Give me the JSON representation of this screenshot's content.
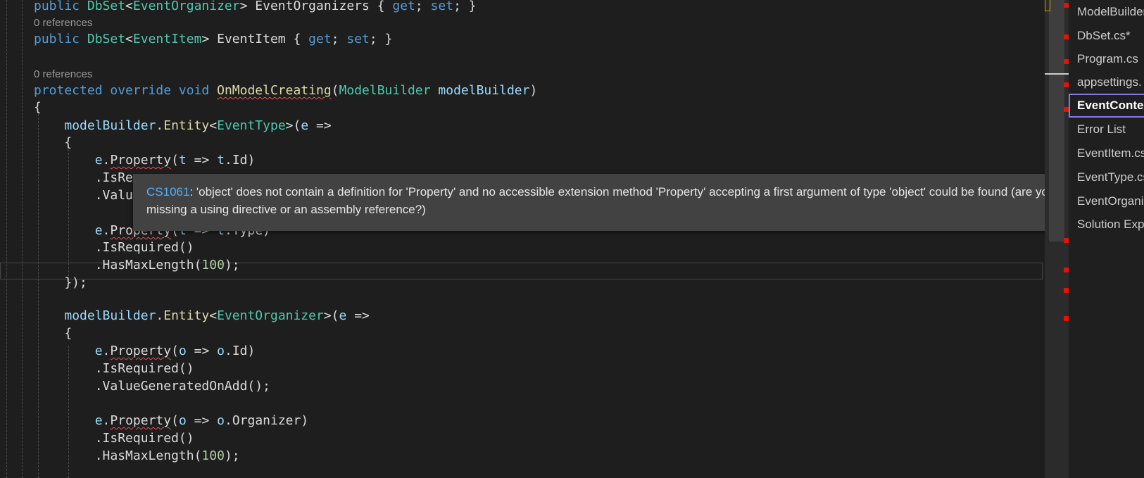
{
  "editor": {
    "code_lens": {
      "references_1": "0 references",
      "references_2": "0 references"
    },
    "lines": [
      {
        "tokens": [
          {
            "t": "public ",
            "c": "kw"
          },
          {
            "t": "DbSet",
            "c": "ty"
          },
          {
            "t": "<",
            "c": ""
          },
          {
            "t": "EventOrganizer",
            "c": "ty"
          },
          {
            "t": "> EventOrganizers { ",
            "c": ""
          },
          {
            "t": "get",
            "c": "kw"
          },
          {
            "t": "; ",
            "c": ""
          },
          {
            "t": "set",
            "c": "kw"
          },
          {
            "t": "; }",
            "c": ""
          }
        ]
      },
      {
        "tokens": [
          {
            "t": "public ",
            "c": "kw"
          },
          {
            "t": "DbSet",
            "c": "ty"
          },
          {
            "t": "<",
            "c": ""
          },
          {
            "t": "EventItem",
            "c": "ty"
          },
          {
            "t": "> EventItem { ",
            "c": ""
          },
          {
            "t": "get",
            "c": "kw"
          },
          {
            "t": "; ",
            "c": ""
          },
          {
            "t": "set",
            "c": "kw"
          },
          {
            "t": "; }",
            "c": ""
          }
        ]
      },
      {
        "tokens": [
          {
            "t": "protected ",
            "c": "kw"
          },
          {
            "t": "override ",
            "c": "kw"
          },
          {
            "t": "void ",
            "c": "kw"
          },
          {
            "t": "OnModelCreating",
            "c": "mth squig"
          },
          {
            "t": "(",
            "c": ""
          },
          {
            "t": "ModelBuilder",
            "c": "ty"
          },
          {
            "t": " ",
            "c": ""
          },
          {
            "t": "modelBuilder",
            "c": "par"
          },
          {
            "t": ")",
            "c": ""
          }
        ]
      },
      {
        "tokens": [
          {
            "t": "{",
            "c": ""
          }
        ]
      },
      {
        "tokens": [
          {
            "t": "    ",
            "c": ""
          },
          {
            "t": "modelBuilder",
            "c": "par"
          },
          {
            "t": ".",
            "c": ""
          },
          {
            "t": "Entity",
            "c": "mth"
          },
          {
            "t": "<",
            "c": ""
          },
          {
            "t": "EventType",
            "c": "ty"
          },
          {
            "t": ">(",
            "c": ""
          },
          {
            "t": "e",
            "c": "par"
          },
          {
            "t": " =>",
            "c": ""
          }
        ]
      },
      {
        "tokens": [
          {
            "t": "    {",
            "c": ""
          }
        ]
      },
      {
        "tokens": [
          {
            "t": "        ",
            "c": ""
          },
          {
            "t": "e",
            "c": "par"
          },
          {
            "t": ".",
            "c": ""
          },
          {
            "t": "Property",
            "c": "squig"
          },
          {
            "t": "(",
            "c": ""
          },
          {
            "t": "t",
            "c": "par"
          },
          {
            "t": " => ",
            "c": ""
          },
          {
            "t": "t",
            "c": "par"
          },
          {
            "t": ".Id)",
            "c": ""
          }
        ]
      },
      {
        "tokens": [
          {
            "t": "        .IsRe",
            "c": ""
          }
        ]
      },
      {
        "tokens": [
          {
            "t": "        .Valu",
            "c": ""
          }
        ]
      },
      {
        "tokens": [
          {
            "t": "        ",
            "c": ""
          },
          {
            "t": "e",
            "c": "par"
          },
          {
            "t": ".",
            "c": ""
          },
          {
            "t": "Property",
            "c": "squig"
          },
          {
            "t": "(",
            "c": ""
          },
          {
            "t": "t",
            "c": "par"
          },
          {
            "t": " => ",
            "c": ""
          },
          {
            "t": "t",
            "c": "par"
          },
          {
            "t": ".Type)",
            "c": ""
          }
        ]
      },
      {
        "tokens": [
          {
            "t": "        .IsRequired()",
            "c": ""
          }
        ]
      },
      {
        "tokens": [
          {
            "t": "        .HasMaxLength(",
            "c": ""
          },
          {
            "t": "100",
            "c": "num"
          },
          {
            "t": ");",
            "c": ""
          }
        ]
      },
      {
        "tokens": [
          {
            "t": "    });",
            "c": ""
          }
        ]
      },
      {
        "tokens": [
          {
            "t": "    ",
            "c": ""
          },
          {
            "t": "modelBuilder",
            "c": "par"
          },
          {
            "t": ".",
            "c": ""
          },
          {
            "t": "Entity",
            "c": "mth"
          },
          {
            "t": "<",
            "c": ""
          },
          {
            "t": "EventOrganizer",
            "c": "ty"
          },
          {
            "t": ">(",
            "c": ""
          },
          {
            "t": "e",
            "c": "par"
          },
          {
            "t": " =>",
            "c": ""
          }
        ]
      },
      {
        "tokens": [
          {
            "t": "    {",
            "c": ""
          }
        ]
      },
      {
        "tokens": [
          {
            "t": "        ",
            "c": ""
          },
          {
            "t": "e",
            "c": "par"
          },
          {
            "t": ".",
            "c": ""
          },
          {
            "t": "Property",
            "c": "squig"
          },
          {
            "t": "(",
            "c": ""
          },
          {
            "t": "o",
            "c": "par"
          },
          {
            "t": " => ",
            "c": ""
          },
          {
            "t": "o",
            "c": "par"
          },
          {
            "t": ".Id)",
            "c": ""
          }
        ]
      },
      {
        "tokens": [
          {
            "t": "        .IsRequired()",
            "c": ""
          }
        ]
      },
      {
        "tokens": [
          {
            "t": "        .ValueGeneratedOnAdd();",
            "c": ""
          }
        ]
      },
      {
        "tokens": [
          {
            "t": "        ",
            "c": ""
          },
          {
            "t": "e",
            "c": "par"
          },
          {
            "t": ".",
            "c": ""
          },
          {
            "t": "Property",
            "c": "squig"
          },
          {
            "t": "(",
            "c": ""
          },
          {
            "t": "o",
            "c": "par"
          },
          {
            "t": " => ",
            "c": ""
          },
          {
            "t": "o",
            "c": "par"
          },
          {
            "t": ".Organizer)",
            "c": ""
          }
        ]
      },
      {
        "tokens": [
          {
            "t": "        .IsRequired()",
            "c": ""
          }
        ]
      },
      {
        "tokens": [
          {
            "t": "        .HasMaxLength(",
            "c": ""
          },
          {
            "t": "100",
            "c": "num"
          },
          {
            "t": ");",
            "c": ""
          }
        ]
      }
    ]
  },
  "tooltip": {
    "code": "CS1061",
    "message": ": 'object' does not contain a definition for 'Property' and no accessible extension method 'Property' accepting a first argument of type 'object' could be found (are you missing a using directive or an assembly reference?)"
  },
  "file_tabs": [
    {
      "label": "ModelBuilder"
    },
    {
      "label": "DbSet.cs*"
    },
    {
      "label": "Program.cs"
    },
    {
      "label": "appsettings."
    },
    {
      "label": "EventContext",
      "active": true
    },
    {
      "label": "Error List"
    },
    {
      "label": "EventItem.cs"
    },
    {
      "label": "EventType.cs"
    },
    {
      "label": "EventOrganiz"
    },
    {
      "label": "Solution Exp"
    }
  ],
  "scrollbar": {
    "error_marker_count": 9
  },
  "colors": {
    "background": "#1e1e1e",
    "keyword": "#569cd6",
    "type": "#4ec9b0",
    "method": "#dcdcaa",
    "parameter": "#9cdcfe",
    "number": "#b5cea8",
    "error_squiggle": "#f14c4c",
    "error_code_link": "#4fb3ff",
    "active_tab_border": "#8575f0"
  }
}
